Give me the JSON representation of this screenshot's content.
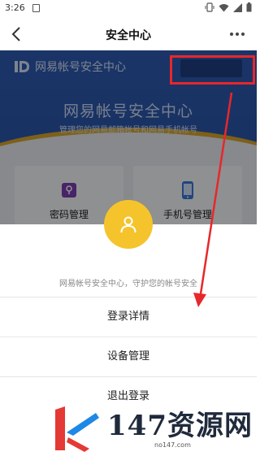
{
  "status_bar": {
    "time": "3:26"
  },
  "nav": {
    "title": "安全中心"
  },
  "banner": {
    "brand": "网易帐号安全中心",
    "title": "网易帐号安全中心",
    "subtitle": "管理您的网易邮箱帐号和网易手机帐号"
  },
  "cards": [
    {
      "label": "密码管理",
      "icon": "lock-icon"
    },
    {
      "label": "手机号管理",
      "icon": "phone-icon"
    }
  ],
  "sheet": {
    "caption": "网易帐号安全中心，守护您的帐号安全",
    "items": [
      "登录详情",
      "设备管理",
      "退出登录"
    ]
  },
  "watermark": {
    "text": "147资源网",
    "domain": "no147.com"
  },
  "colors": {
    "banner_blue": "#2f5cb3",
    "avatar_yellow": "#f5c42c",
    "annotation_red": "#e8272a"
  }
}
